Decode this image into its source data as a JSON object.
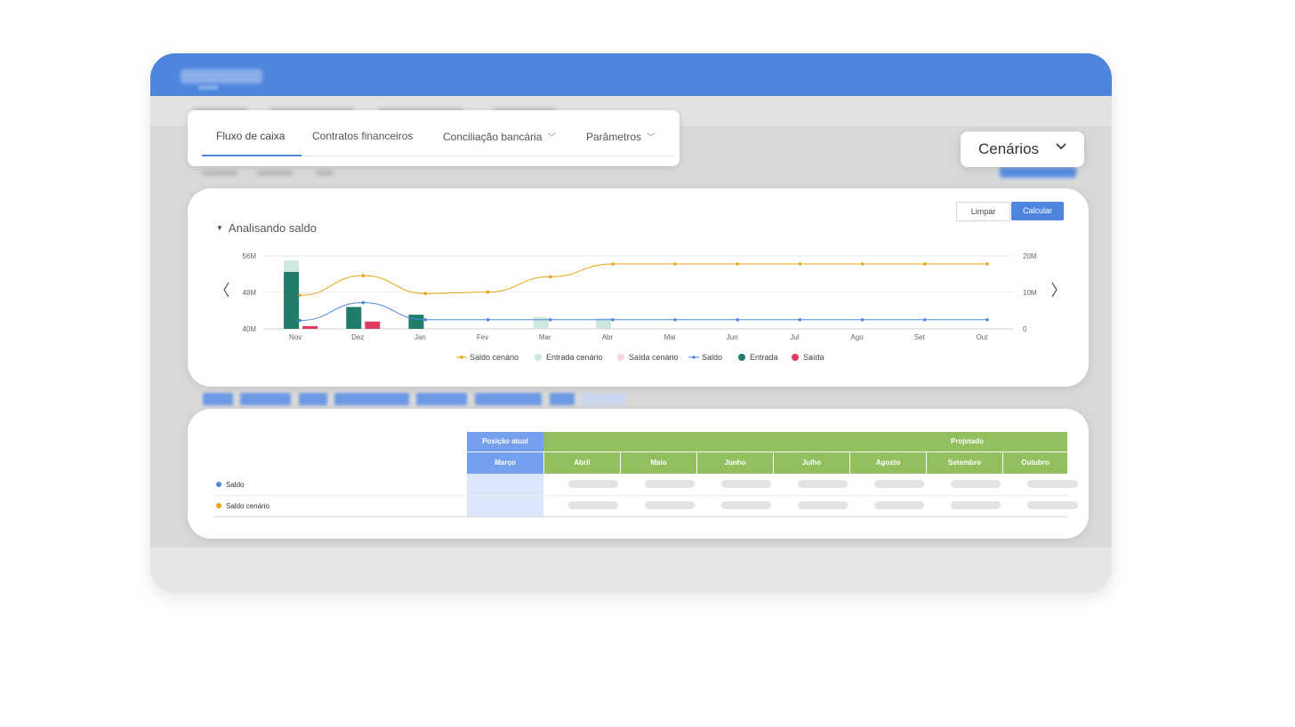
{
  "tabs": [
    {
      "label": "Fluxo de caixa",
      "active": true,
      "dropdown": false
    },
    {
      "label": "Contratos financeiros",
      "active": false,
      "dropdown": false
    },
    {
      "label": "Conciliação bancária",
      "active": false,
      "dropdown": true
    },
    {
      "label": "Parâmetros",
      "active": false,
      "dropdown": true
    }
  ],
  "scenarios_button": {
    "label": "Cenários",
    "icon": "chevron-down-icon"
  },
  "actions": {
    "clear_label": "Limpar",
    "calculate_label": "Calcular"
  },
  "section": {
    "title": "Analisando saldo",
    "icon": "triangle-down-icon"
  },
  "nav": {
    "prev_icon": "chevron-left-icon",
    "next_icon": "chevron-right-icon"
  },
  "colors": {
    "primary": "#4e86de",
    "saldo_cenario": "#e8a317",
    "entrada_cenario": "#cfe7e1",
    "saida_cenario": "#f9d5dc",
    "saldo": "#4e86de",
    "entrada": "#217c6c",
    "saida": "#e03b63",
    "projetado_header": "#92c05e",
    "posicao_header": "#74a0ee"
  },
  "chart_data": {
    "type": "bar",
    "categories": [
      "Nov",
      "Dez",
      "Jan",
      "Fev",
      "Mar",
      "Abr",
      "Mai",
      "Jun",
      "Jul",
      "Ago",
      "Set",
      "Out"
    ],
    "y_left": {
      "ticks": [
        "56M",
        "48M",
        "40M"
      ],
      "min": 40,
      "max": 56,
      "unit": "M"
    },
    "y_right": {
      "ticks": [
        "20M",
        "10M",
        "0"
      ],
      "min": 0,
      "max": 20,
      "unit": "M"
    },
    "grid": true,
    "legend_position": "bottom",
    "bars": [
      {
        "name": "Entrada cenário",
        "color": "#cfe7e1",
        "values": [
          55.0,
          null,
          null,
          null,
          42.6,
          42.3,
          null,
          null,
          null,
          null,
          null,
          null
        ]
      },
      {
        "name": "Entrada",
        "color": "#217c6c",
        "values": [
          52.5,
          44.8,
          43.1,
          null,
          null,
          null,
          null,
          null,
          null,
          null,
          null,
          null
        ]
      },
      {
        "name": "Saída cenário",
        "color": "#f9d5dc",
        "values": [
          null,
          null,
          null,
          null,
          null,
          null,
          null,
          null,
          null,
          null,
          null,
          null
        ]
      },
      {
        "name": "Saída",
        "color": "#e03b63",
        "values": [
          40.6,
          41.6,
          null,
          null,
          null,
          null,
          null,
          null,
          null,
          null,
          null,
          null
        ]
      }
    ],
    "lines": [
      {
        "name": "Saldo cenário",
        "color": "#e8a317",
        "axis": "right",
        "values": [
          9.2,
          14.6,
          9.7,
          10.1,
          14.3,
          17.8,
          17.8,
          17.8,
          17.8,
          17.8,
          17.8,
          17.8
        ]
      },
      {
        "name": "Saldo",
        "color": "#4e86de",
        "axis": "right",
        "values": [
          2.3,
          7.2,
          2.5,
          2.5,
          2.5,
          2.5,
          2.5,
          2.5,
          2.5,
          2.5,
          2.5,
          2.5
        ]
      }
    ],
    "legend": [
      {
        "name": "Saldo cenário",
        "kind": "line",
        "color": "#e8a317"
      },
      {
        "name": "Entrada cenário",
        "kind": "dot",
        "color": "#cfe7e1"
      },
      {
        "name": "Saída cenário",
        "kind": "dot",
        "color": "#f9d5dc"
      },
      {
        "name": "Saldo",
        "kind": "line",
        "color": "#4e86de"
      },
      {
        "name": "Entrada",
        "kind": "dot",
        "color": "#217c6c"
      },
      {
        "name": "Saída",
        "kind": "dot",
        "color": "#e03b63"
      }
    ]
  },
  "table": {
    "group_current": "Posição atual",
    "group_projected": "Projetado",
    "current_month": "Março",
    "projected_months": [
      "Abril",
      "Maio",
      "Junho",
      "Julho",
      "Agosto",
      "Setembro",
      "Outubro"
    ],
    "rows": [
      {
        "label": "Saldo",
        "color": "#4e86de"
      },
      {
        "label": "Saldo cenário",
        "color": "#e8a317"
      }
    ]
  }
}
